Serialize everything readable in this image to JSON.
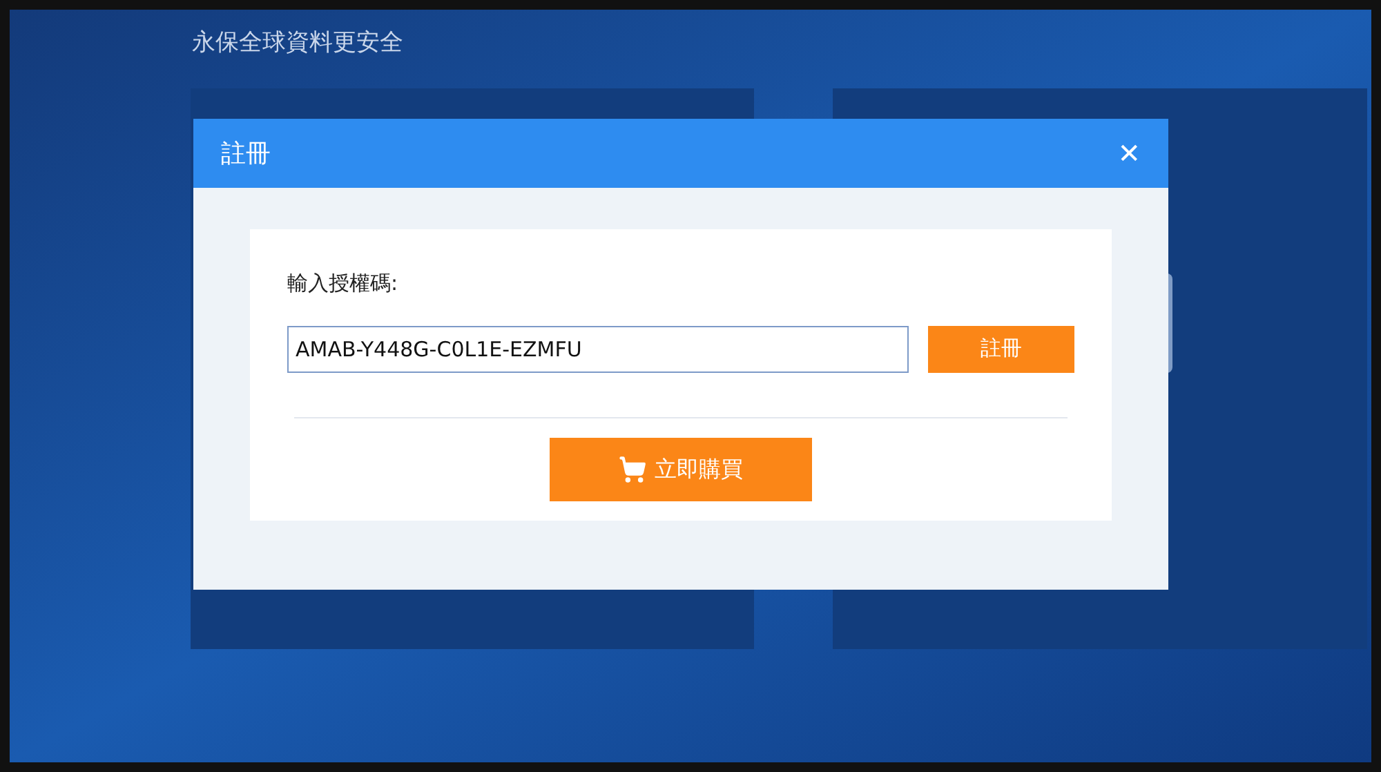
{
  "page": {
    "heading": "永保全球資料更安全"
  },
  "dialog": {
    "title": "註冊",
    "close": "✕",
    "field_label": "輸入授權碼:",
    "license_code": "AMAB-Y448G-C0L1E-EZMFU",
    "register_button": "註冊",
    "buy_button": "立即購買"
  }
}
